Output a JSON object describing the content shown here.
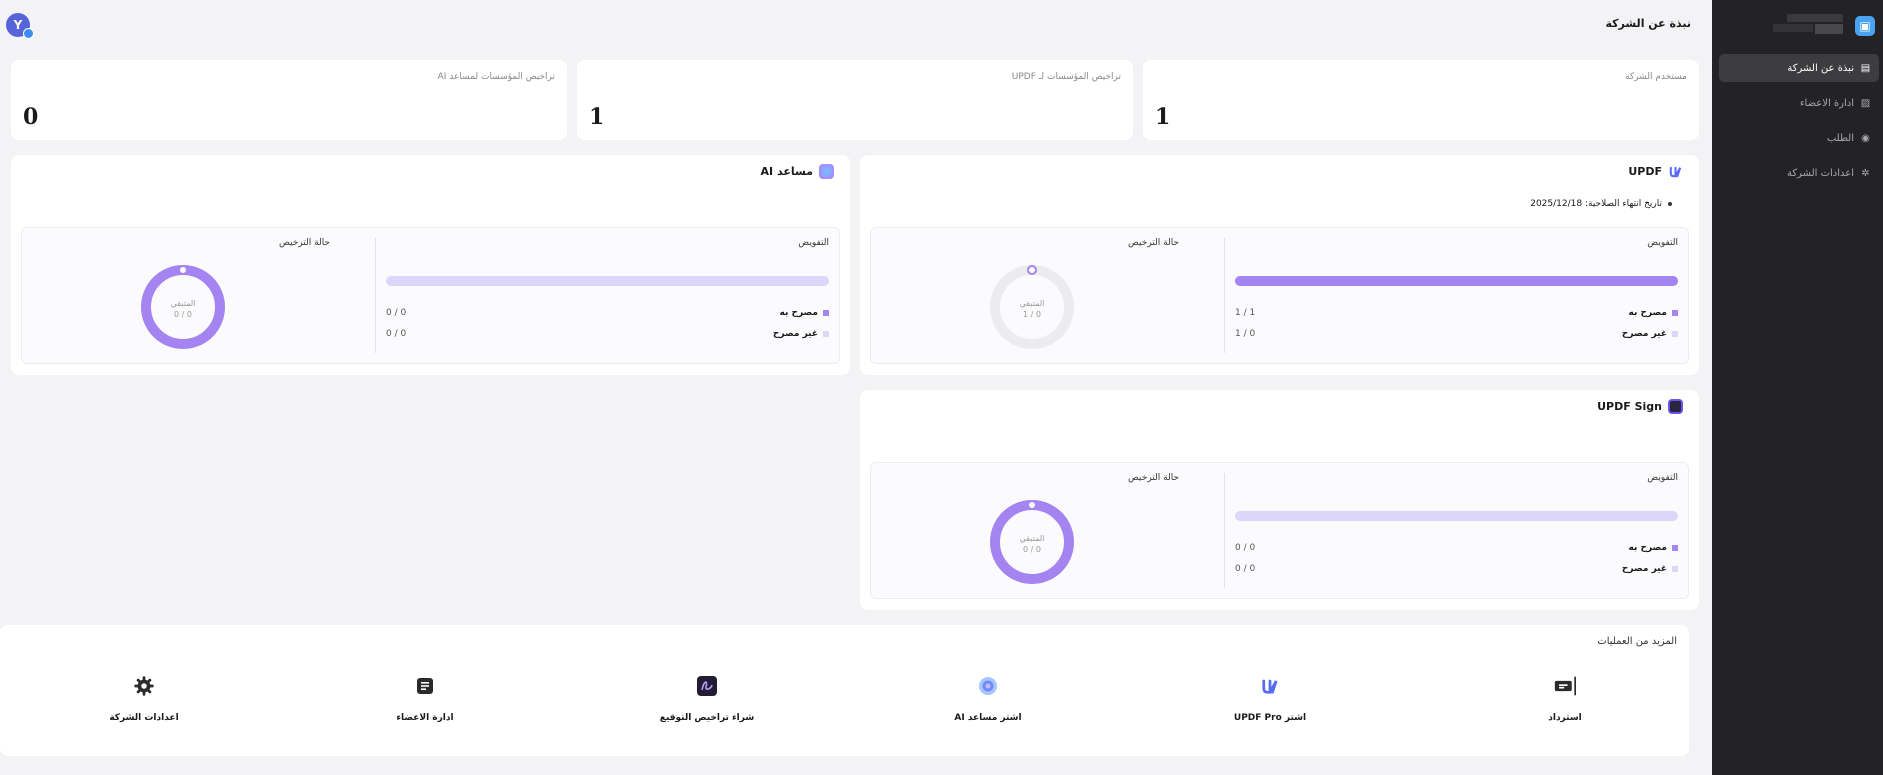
{
  "header": {
    "title": "نبذة عن الشركة",
    "avatar_letter": "Y"
  },
  "sidebar": {
    "logo_glyph": "▣",
    "items": [
      {
        "label": "نبذة عن الشركة",
        "icon": "building-icon",
        "glyph": "▤",
        "active": true
      },
      {
        "label": "ادارة الاعضاء",
        "icon": "members-icon",
        "glyph": "▨",
        "active": false
      },
      {
        "label": "الطلب",
        "icon": "order-icon",
        "glyph": "◉",
        "active": false
      },
      {
        "label": "اعدادات الشركة",
        "icon": "gear-icon",
        "glyph": "✲",
        "active": false
      }
    ]
  },
  "stats": [
    {
      "label": "مستخدم الشركة",
      "value": "1"
    },
    {
      "label": "تراخيص المؤسسات لـ UPDF",
      "value": "1"
    },
    {
      "label": "تراخيص المؤسسات لمساعد AI",
      "value": "0"
    }
  ],
  "products": {
    "updf": {
      "title": "UPDF",
      "expiry": "تاريخ انتهاء الصلاحية: 2025/12/18",
      "alloc_title": "التفويض",
      "used_fraction": 1.0,
      "legend": [
        {
          "name": "مصرح به",
          "value": "1 / 1",
          "color": "#a484f1"
        },
        {
          "name": "غير مصرح",
          "value": "1 / 0",
          "color": "#ddd6fb"
        }
      ],
      "status_title": "حالة الترخيص",
      "donut_label": "المتبقي",
      "donut_value": "1 / 0",
      "donut_fraction": 0.0
    },
    "ai": {
      "title": "مساعد AI",
      "alloc_title": "التفويض",
      "used_fraction": 0.0,
      "legend": [
        {
          "name": "مصرح به",
          "value": "0 / 0",
          "color": "#a484f1"
        },
        {
          "name": "غير مصرح",
          "value": "0 / 0",
          "color": "#ddd6fb"
        }
      ],
      "status_title": "حالة الترخيص",
      "donut_label": "المتبقي",
      "donut_value": "0 / 0",
      "donut_fraction": 1.0
    },
    "sign": {
      "title": "UPDF Sign",
      "alloc_title": "التفويض",
      "used_fraction": 0.0,
      "legend": [
        {
          "name": "مصرح به",
          "value": "0 / 0",
          "color": "#a484f1"
        },
        {
          "name": "غير مصرح",
          "value": "0 / 0",
          "color": "#ddd6fb"
        }
      ],
      "status_title": "حالة الترخيص",
      "donut_label": "المتبقي",
      "donut_value": "0 / 0",
      "donut_fraction": 1.0
    }
  },
  "more": {
    "title": "المزيد من العمليات",
    "actions": [
      {
        "label": "استرداد",
        "icon": "ticket-icon"
      },
      {
        "label": "اشتر UPDF Pro",
        "icon": "updf-logo-icon"
      },
      {
        "label": "اشتر مساعد AI",
        "icon": "ai-assistant-icon"
      },
      {
        "label": "شراء تراخيص التوقيع",
        "icon": "signature-icon"
      },
      {
        "label": "ادارة الاعضاء",
        "icon": "document-icon"
      },
      {
        "label": "اعدادات الشركة",
        "icon": "gear-icon"
      }
    ]
  },
  "colors": {
    "accent": "#a484f1",
    "accent_light": "#ddd6fb",
    "sidebar_bg": "#232325",
    "donut_empty": "#ececee"
  }
}
